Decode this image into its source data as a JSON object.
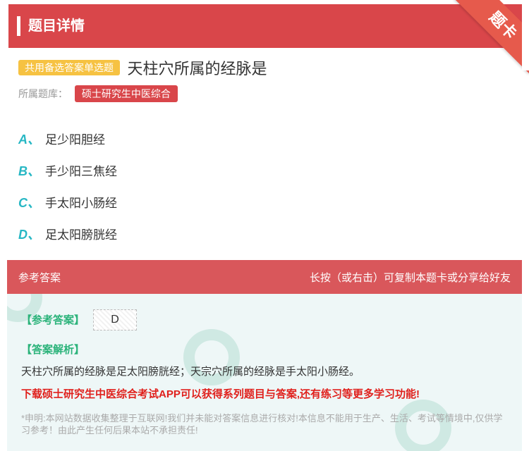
{
  "header": {
    "title": "题目详情"
  },
  "ribbon": {
    "label": "题卡"
  },
  "question": {
    "type_badge": "共用备选答案单选题",
    "text": "天柱穴所属的经脉是"
  },
  "bank": {
    "label": "所属题库：",
    "name": "硕士研究生中医综合"
  },
  "options": [
    {
      "letter": "A、",
      "text": "足少阳胆经"
    },
    {
      "letter": "B、",
      "text": "手少阳三焦经"
    },
    {
      "letter": "C、",
      "text": "手太阳小肠经"
    },
    {
      "letter": "D、",
      "text": "足太阳膀胱经"
    }
  ],
  "answer_header": {
    "left": "参考答案",
    "right": "长按（或右击）可复制本题卡或分享给好友"
  },
  "answer": {
    "label": "【参考答案】",
    "value": "D",
    "analysis_label": "【答案解析】",
    "analysis_text": "天柱穴所属的经脉是足太阳膀胱经；天宗穴所属的经脉是手太阳小肠经。",
    "promo": "下载硕士研究生中医综合考试APP可以获得系列题目与答案,还有练习等更多学习功能!",
    "disclaimer": "*申明:本网站数据收集整理于互联网!我们并未能对答案信息进行核对!本信息不能用于生产、生活、考试等情境中,仅供学习参考！由此产生任何后果本站不承担责任!"
  },
  "colors": {
    "header": "#d9464a",
    "accent_teal": "#27b7c4",
    "badge_yellow": "#f6c242",
    "answer_green": "#2bb37a",
    "promo_red": "#e0201c"
  }
}
